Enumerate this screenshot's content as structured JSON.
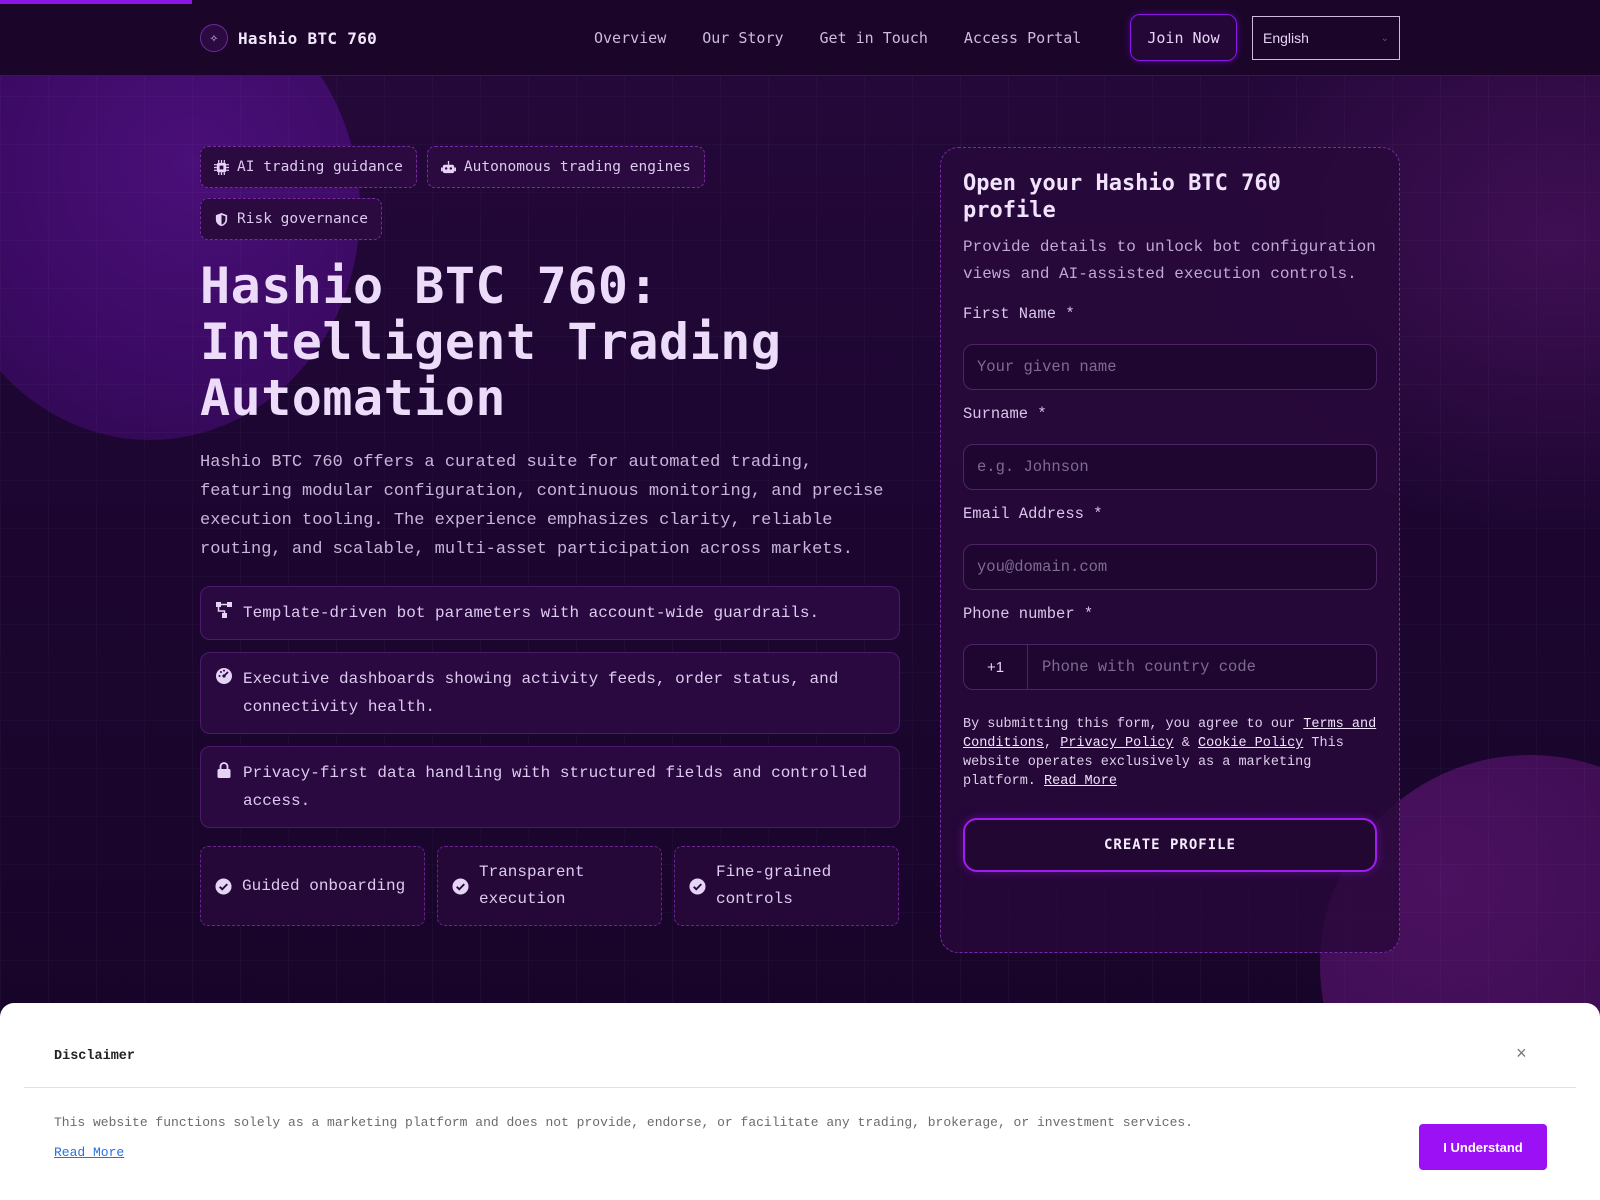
{
  "header": {
    "brand": "Hashio BTC 760",
    "nav": [
      "Overview",
      "Our Story",
      "Get in Touch",
      "Access Portal"
    ],
    "join_label": "Join Now",
    "language": "English"
  },
  "hero": {
    "tags": [
      "AI trading guidance",
      "Autonomous trading engines",
      "Risk governance"
    ],
    "title_lines": [
      "Hashio BTC 760:",
      "Intelligent Trading",
      "Automation"
    ],
    "lead": "Hashio BTC 760 offers a curated suite for automated trading, featuring modular configuration, continuous monitoring, and precise execution tooling. The experience emphasizes clarity, reliable routing, and scalable, multi-asset participation across markets.",
    "features": [
      {
        "icon": "nodes-icon",
        "text": "Template-driven bot parameters with account-wide guardrails."
      },
      {
        "icon": "dashboard-icon",
        "text": "Executive dashboards showing activity feeds, order status, and connectivity health."
      },
      {
        "icon": "lock-icon",
        "text": "Privacy-first data handling with structured fields and controlled access."
      }
    ],
    "highlights": [
      "Guided onboarding",
      "Transparent execution",
      "Fine-grained controls"
    ]
  },
  "form": {
    "title": "Open your Hashio BTC 760 profile",
    "subtitle": "Provide details to unlock bot configuration views and AI-assisted execution controls.",
    "first_name_label": "First Name *",
    "first_name_placeholder": "Your given name",
    "surname_label": "Surname *",
    "surname_placeholder": "e.g. Johnson",
    "email_label": "Email Address *",
    "email_placeholder": "you@domain.com",
    "phone_label": "Phone number *",
    "phone_code": "+1",
    "phone_placeholder": "Phone with country code",
    "legal_prefix": "By submitting this form, you agree to our",
    "terms": "Terms and Conditions",
    "privacy": "Privacy Policy",
    "amp": "&",
    "cookie": "Cookie Policy",
    "marketing": "This website operates exclusively as a marketing platform.",
    "read_more": "Read More",
    "submit": "CREATE PROFILE"
  },
  "disclaimer": {
    "title": "Disclaimer",
    "text": "This website functions solely as a marketing platform and does not provide, endorse, or facilitate any trading, brokerage, or investment services.",
    "read_more": "Read More",
    "button": "I Understand"
  },
  "colors": {
    "accent": "#8a17e6",
    "background": "#1a0628",
    "button": "#9b10f5"
  }
}
